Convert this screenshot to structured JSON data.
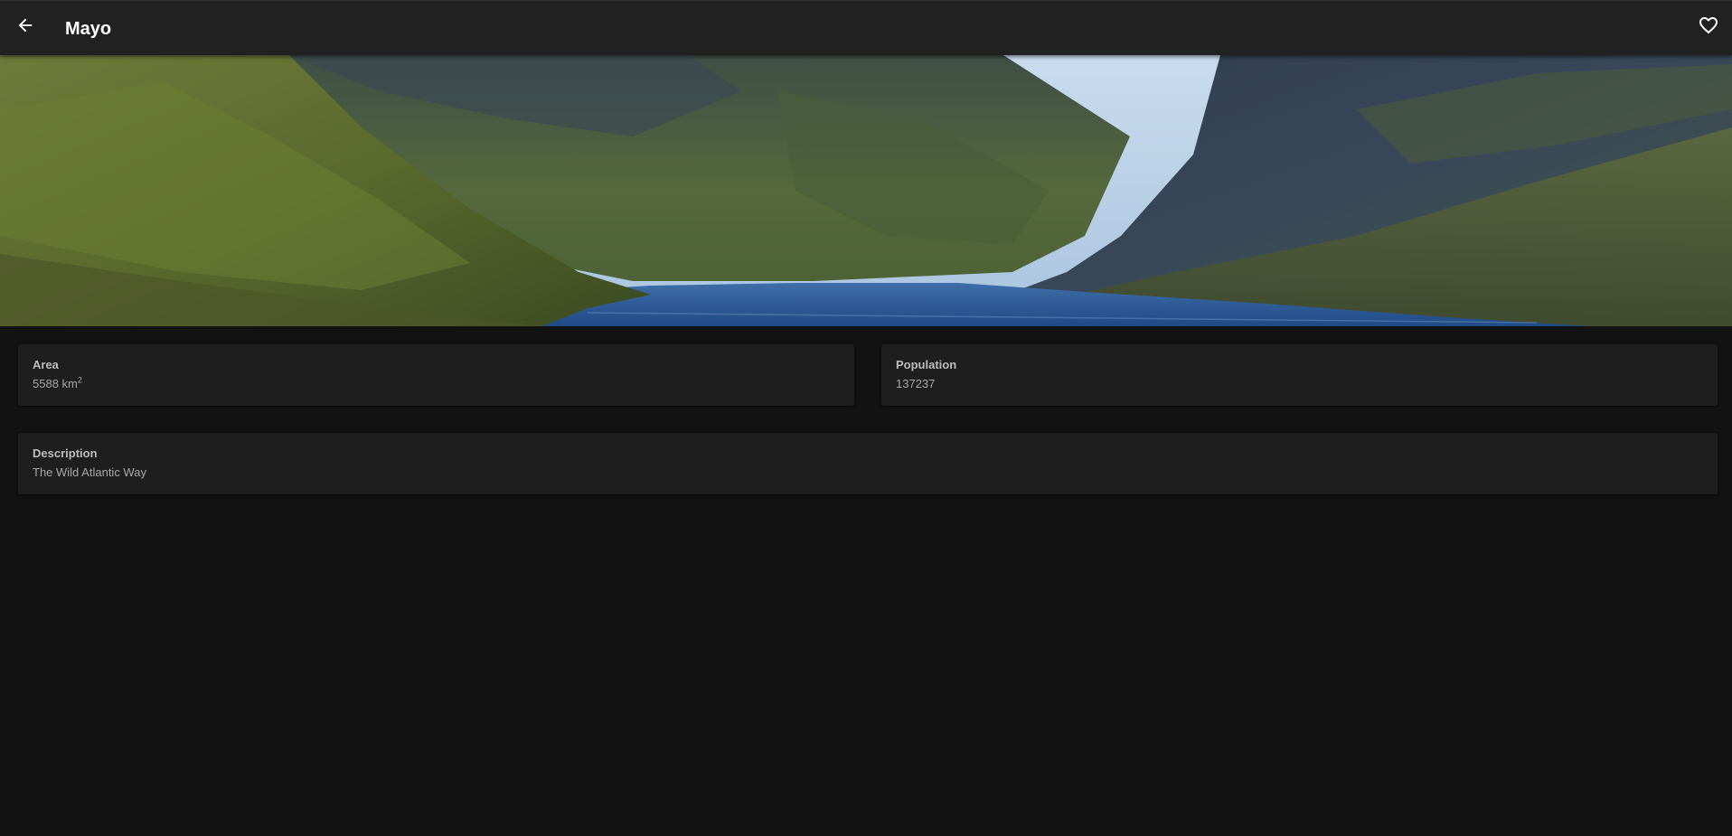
{
  "appbar": {
    "title": "Mayo",
    "back_icon": "arrow-left-icon",
    "favorite_icon": "heart-outline-icon"
  },
  "hero": {
    "alt": "Mayo"
  },
  "details": {
    "area": {
      "label": "Area",
      "value": "5588 km",
      "unit_sup": "2"
    },
    "population": {
      "label": "Population",
      "value": "137237"
    },
    "description": {
      "label": "Description",
      "value": "The Wild Atlantic Way"
    }
  },
  "colors": {
    "background": "#121212",
    "appbar": "#212121",
    "card": "#1e1e1e"
  }
}
